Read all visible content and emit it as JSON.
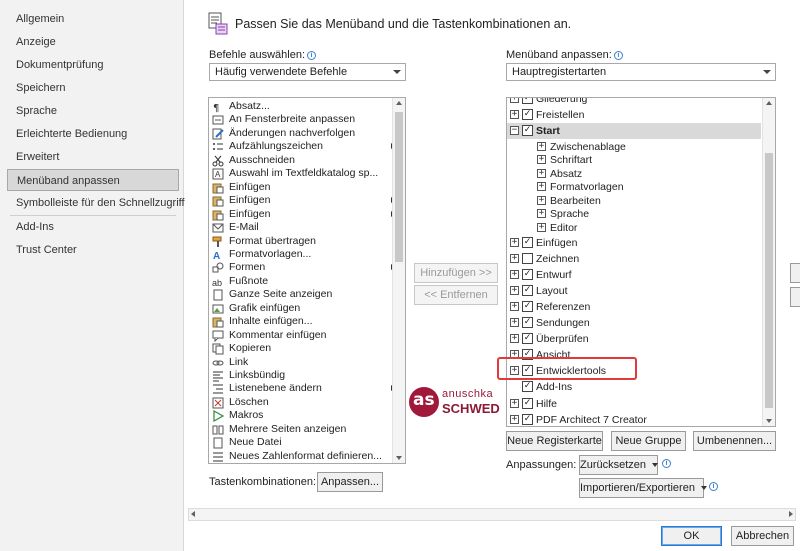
{
  "sidebar": {
    "items": [
      {
        "label": "Allgemein",
        "selected": false
      },
      {
        "label": "Anzeige",
        "selected": false
      },
      {
        "label": "Dokumentprüfung",
        "selected": false
      },
      {
        "label": "Speichern",
        "selected": false
      },
      {
        "label": "Sprache",
        "selected": false
      },
      {
        "label": "Erleichterte Bedienung",
        "selected": false
      },
      {
        "label": "Erweitert",
        "selected": false
      },
      {
        "label": "Menüband anpassen",
        "selected": true
      },
      {
        "label": "Symbolleiste für den Schnellzugriff",
        "selected": false
      },
      {
        "label": "Add-Ins",
        "selected": false
      },
      {
        "label": "Trust Center",
        "selected": false
      }
    ]
  },
  "header": {
    "title": "Passen Sie das Menüband und die Tastenkombinationen an.",
    "icon": "ribbon-customize-icon"
  },
  "commands": {
    "label": "Befehle auswählen:",
    "selected": "Häufig verwendete Befehle",
    "items": [
      {
        "label": "Absatz...",
        "icon": "paragraph-icon",
        "submenu": false
      },
      {
        "label": "An Fensterbreite anpassen",
        "icon": "fit-width-icon",
        "submenu": false
      },
      {
        "label": "Änderungen nachverfolgen",
        "icon": "track-changes-icon",
        "submenu": false
      },
      {
        "label": "Aufzählungszeichen",
        "icon": "bullets-icon",
        "submenu": true
      },
      {
        "label": "Ausschneiden",
        "icon": "scissors-icon",
        "submenu": false
      },
      {
        "label": "Auswahl im Textfeldkatalog sp...",
        "icon": "textbox-icon",
        "submenu": false
      },
      {
        "label": "Einfügen",
        "icon": "paste-icon",
        "submenu": false
      },
      {
        "label": "Einfügen",
        "icon": "paste-icon",
        "submenu": true
      },
      {
        "label": "Einfügen",
        "icon": "paste-icon",
        "submenu": true
      },
      {
        "label": "E-Mail",
        "icon": "email-icon",
        "submenu": false
      },
      {
        "label": "Format übertragen",
        "icon": "format-painter-icon",
        "submenu": false
      },
      {
        "label": "Formatvorlagen...",
        "icon": "styles-icon",
        "submenu": false
      },
      {
        "label": "Formen",
        "icon": "shapes-icon",
        "submenu": true
      },
      {
        "label": "Fußnote",
        "icon": "footnote-icon",
        "submenu": false
      },
      {
        "label": "Ganze Seite anzeigen",
        "icon": "full-page-icon",
        "submenu": false
      },
      {
        "label": "Grafik einfügen",
        "icon": "picture-icon",
        "submenu": false
      },
      {
        "label": "Inhalte einfügen...",
        "icon": "paste-special-icon",
        "submenu": false
      },
      {
        "label": "Kommentar einfügen",
        "icon": "comment-icon",
        "submenu": false
      },
      {
        "label": "Kopieren",
        "icon": "copy-icon",
        "submenu": false
      },
      {
        "label": "Link",
        "icon": "link-icon",
        "submenu": false
      },
      {
        "label": "Linksbündig",
        "icon": "align-left-icon",
        "submenu": false
      },
      {
        "label": "Listenebene ändern",
        "icon": "list-level-icon",
        "submenu": true
      },
      {
        "label": "Löschen",
        "icon": "delete-icon",
        "submenu": false
      },
      {
        "label": "Makros",
        "icon": "macros-icon",
        "submenu": false
      },
      {
        "label": "Mehrere Seiten anzeigen",
        "icon": "multiple-pages-icon",
        "submenu": false
      },
      {
        "label": "Neue Datei",
        "icon": "new-file-icon",
        "submenu": false
      },
      {
        "label": "Neues Zahlenformat definieren...",
        "icon": "number-format-icon",
        "submenu": false
      }
    ]
  },
  "actions": {
    "add": "Hinzufügen >>",
    "remove": "<< Entfernen"
  },
  "watermark": {
    "line1": "anuschka",
    "line2": "SCHWED",
    "initials": "as"
  },
  "shortcuts": {
    "label": "Tastenkombinationen:",
    "button": "Anpassen..."
  },
  "ribbon": {
    "label": "Menüband anpassen:",
    "selected": "Hauptregistertarten",
    "tree": [
      {
        "label": "Gliederung",
        "level": 0,
        "expander": "+",
        "checked": true,
        "bold": false,
        "selected": false,
        "highlight": false
      },
      {
        "label": "Freistellen",
        "level": 0,
        "expander": "+",
        "checked": true,
        "bold": false,
        "selected": false,
        "highlight": false
      },
      {
        "label": "Start",
        "level": 0,
        "expander": "−",
        "checked": true,
        "bold": true,
        "selected": true,
        "highlight": false
      },
      {
        "label": "Zwischenablage",
        "level": 1,
        "expander": "+",
        "checked": null,
        "bold": false,
        "selected": false,
        "highlight": false
      },
      {
        "label": "Schriftart",
        "level": 1,
        "expander": "+",
        "checked": null,
        "bold": false,
        "selected": false,
        "highlight": false
      },
      {
        "label": "Absatz",
        "level": 1,
        "expander": "+",
        "checked": null,
        "bold": false,
        "selected": false,
        "highlight": false
      },
      {
        "label": "Formatvorlagen",
        "level": 1,
        "expander": "+",
        "checked": null,
        "bold": false,
        "selected": false,
        "highlight": false
      },
      {
        "label": "Bearbeiten",
        "level": 1,
        "expander": "+",
        "checked": null,
        "bold": false,
        "selected": false,
        "highlight": false
      },
      {
        "label": "Sprache",
        "level": 1,
        "expander": "+",
        "checked": null,
        "bold": false,
        "selected": false,
        "highlight": false
      },
      {
        "label": "Editor",
        "level": 1,
        "expander": "+",
        "checked": null,
        "bold": false,
        "selected": false,
        "highlight": false
      },
      {
        "label": "Einfügen",
        "level": 0,
        "expander": "+",
        "checked": true,
        "bold": false,
        "selected": false,
        "highlight": false
      },
      {
        "label": "Zeichnen",
        "level": 0,
        "expander": "+",
        "checked": false,
        "bold": false,
        "selected": false,
        "highlight": false
      },
      {
        "label": "Entwurf",
        "level": 0,
        "expander": "+",
        "checked": true,
        "bold": false,
        "selected": false,
        "highlight": false
      },
      {
        "label": "Layout",
        "level": 0,
        "expander": "+",
        "checked": true,
        "bold": false,
        "selected": false,
        "highlight": false
      },
      {
        "label": "Referenzen",
        "level": 0,
        "expander": "+",
        "checked": true,
        "bold": false,
        "selected": false,
        "highlight": false
      },
      {
        "label": "Sendungen",
        "level": 0,
        "expander": "+",
        "checked": true,
        "bold": false,
        "selected": false,
        "highlight": false
      },
      {
        "label": "Überprüfen",
        "level": 0,
        "expander": "+",
        "checked": true,
        "bold": false,
        "selected": false,
        "highlight": false
      },
      {
        "label": "Ansicht",
        "level": 0,
        "expander": "+",
        "checked": true,
        "bold": false,
        "selected": false,
        "highlight": false
      },
      {
        "label": "Entwicklertools",
        "level": 0,
        "expander": "+",
        "checked": true,
        "bold": false,
        "selected": false,
        "highlight": true
      },
      {
        "label": "Add-Ins",
        "level": 0,
        "expander": "",
        "checked": true,
        "bold": false,
        "selected": false,
        "highlight": false
      },
      {
        "label": "Hilfe",
        "level": 0,
        "expander": "+",
        "checked": true,
        "bold": false,
        "selected": false,
        "highlight": false
      },
      {
        "label": "PDF Architect 7 Creator",
        "level": 0,
        "expander": "+",
        "checked": true,
        "bold": false,
        "selected": false,
        "highlight": false
      }
    ]
  },
  "ribbon_buttons": {
    "new_tab": "Neue Registerkarte",
    "new_group": "Neue Gruppe",
    "rename": "Umbenennen..."
  },
  "customizations": {
    "label": "Anpassungen:",
    "reset": "Zurücksetzen",
    "import_export": "Importieren/Exportieren"
  },
  "footer": {
    "ok": "OK",
    "cancel": "Abbrechen"
  },
  "colors": {
    "highlight_border": "#e03a3a",
    "watermark_circle": "#a0183a",
    "accent": "#2a78d6"
  }
}
